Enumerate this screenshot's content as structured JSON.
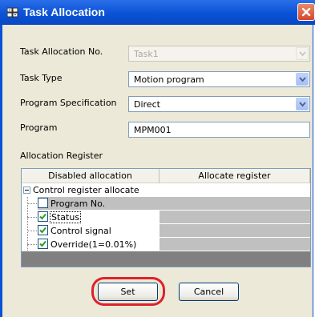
{
  "window": {
    "title": "Task Allocation",
    "close_icon": "close-icon",
    "app_icon": "task-allocation-icon"
  },
  "fields": {
    "task_allocation_no": {
      "label": "Task Allocation No.",
      "value": "Task1",
      "enabled": false
    },
    "task_type": {
      "label": "Task Type",
      "value": "Motion program"
    },
    "program_specification": {
      "label": "Program Specification",
      "value": "Direct"
    },
    "program": {
      "label": "Program",
      "value": "MPM001"
    }
  },
  "allocation_register": {
    "label": "Allocation Register",
    "columns": [
      "Disabled allocation",
      "Allocate register"
    ],
    "group": {
      "label": "Control register allocate",
      "expanded": true
    },
    "items": [
      {
        "label": "Program No.",
        "checked": false
      },
      {
        "label": "Status",
        "checked": true
      },
      {
        "label": "Control signal",
        "checked": true
      },
      {
        "label": "Override(1=0.01%)",
        "checked": true
      }
    ]
  },
  "buttons": {
    "set": "Set",
    "cancel": "Cancel"
  },
  "colors": {
    "titlebar": "#0a52d6",
    "highlight": "#e0202a",
    "dialog_bg": "#ece9d8"
  }
}
